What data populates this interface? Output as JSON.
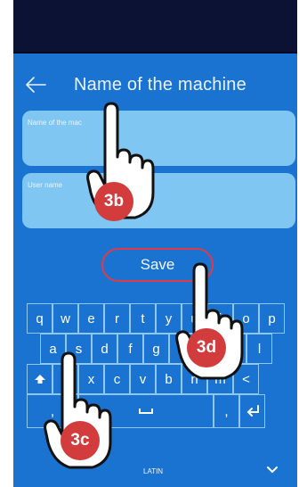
{
  "header": {
    "title": "Name of the machine",
    "back_icon": "arrow-left-icon"
  },
  "form": {
    "machine_name_placeholder": "Name of the mac",
    "user_name_placeholder": "User name",
    "save_label": "Save"
  },
  "keyboard": {
    "row1": [
      "q",
      "w",
      "e",
      "r",
      "t",
      "y",
      "u",
      "i",
      "o",
      "p"
    ],
    "row2": [
      "a",
      "s",
      "d",
      "f",
      "g",
      "h",
      "j",
      "k",
      "l"
    ],
    "row3": [
      "shift",
      "z",
      "x",
      "c",
      "v",
      "b",
      "n",
      "m",
      "<"
    ],
    "row4": [
      ",",
      "space",
      ",",
      "enter"
    ],
    "language_label": "LATIN",
    "collapse_icon": "chevron-down-icon"
  },
  "annotations": {
    "b": "3b",
    "c": "3c",
    "d": "3d"
  },
  "colors": {
    "screen_bg": "#1b73d1",
    "status_bar": "#0c1233",
    "field_bg": "#7fc6f2",
    "save_border": "#e23a44",
    "badge": "#d23c3c"
  }
}
